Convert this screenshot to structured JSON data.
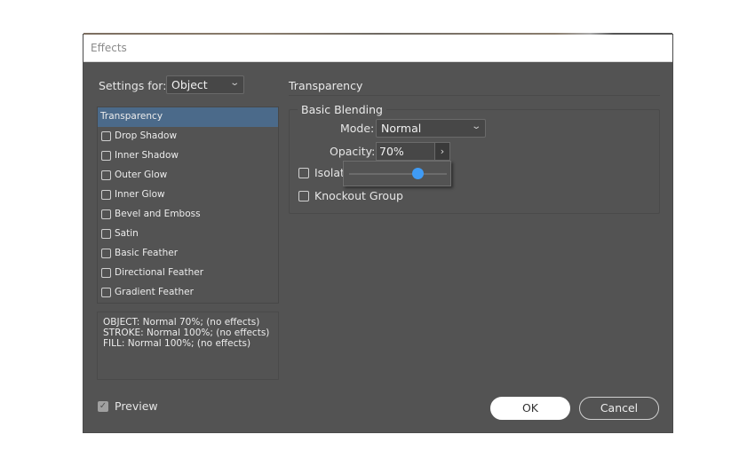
{
  "window": {
    "title": "Effects"
  },
  "settings_for": {
    "label": "Settings for:",
    "value": "Object"
  },
  "effects_list": {
    "items": [
      {
        "label": "Transparency",
        "selected": true,
        "checkbox": false
      },
      {
        "label": "Drop Shadow",
        "checked": false
      },
      {
        "label": "Inner Shadow",
        "checked": false
      },
      {
        "label": "Outer Glow",
        "checked": false
      },
      {
        "label": "Inner Glow",
        "checked": false
      },
      {
        "label": "Bevel and Emboss",
        "checked": false
      },
      {
        "label": "Satin",
        "checked": false
      },
      {
        "label": "Basic Feather",
        "checked": false
      },
      {
        "label": "Directional Feather",
        "checked": false
      },
      {
        "label": "Gradient Feather",
        "checked": false
      }
    ]
  },
  "summary": {
    "lines": [
      "OBJECT: Normal 70%; (no effects)",
      "STROKE: Normal 100%; (no effects)",
      "FILL: Normal 100%; (no effects)"
    ]
  },
  "panel": {
    "title": "Transparency",
    "group_title": "Basic Blending",
    "mode": {
      "label": "Mode:",
      "value": "Normal"
    },
    "opacity": {
      "label": "Opacity:",
      "value": "70%",
      "slider_fraction": 0.7,
      "expand_icon": "chevron-right-icon"
    },
    "isolate": {
      "label": "Isolate Blending",
      "visible_label": "Isolat",
      "checked": false
    },
    "knockout": {
      "label": "Knockout Group",
      "checked": false
    }
  },
  "preview": {
    "label": "Preview",
    "checked": true
  },
  "buttons": {
    "ok": "OK",
    "cancel": "Cancel"
  },
  "colors": {
    "dialog_bg": "#535353",
    "selection": "#4b6a8a",
    "slider_thumb": "#3f9bf5"
  }
}
